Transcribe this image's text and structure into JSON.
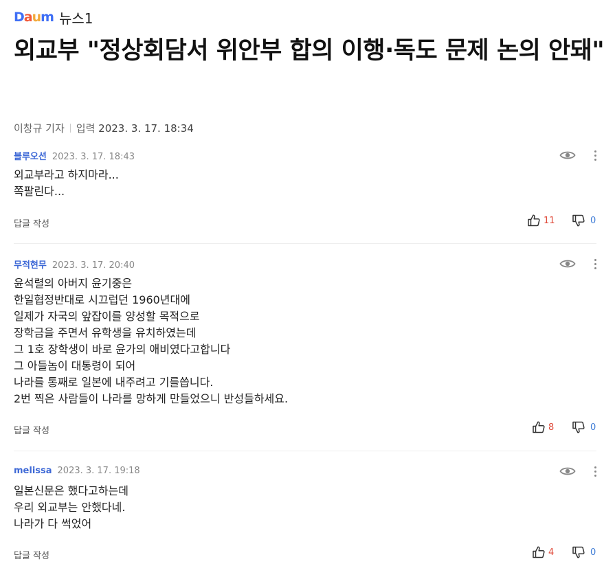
{
  "header": {
    "logo_letters": [
      "D",
      "a",
      "u",
      "m"
    ],
    "logo_colors": [
      "#3f6ff5",
      "#f25a3a",
      "#f2a93b",
      "#3f6ff5"
    ],
    "source": "뉴스1"
  },
  "article": {
    "title": "외교부 \"정상회담서 위안부 합의 이행·독도 문제 논의 안돼\"",
    "reporter": "이창규 기자",
    "date_label": "입력",
    "date": "2023. 3. 17. 18:34"
  },
  "comments": [
    {
      "author": "블루오션",
      "time": "2023. 3. 17. 18:43",
      "body": "외교부라고 하지마라...\n쪽팔린다...",
      "reply_label": "답글 작성",
      "likes": "11",
      "dislikes": "0"
    },
    {
      "author": "무적현무",
      "time": "2023. 3. 17. 20:40",
      "body": "윤석렬의 아버지 윤기중은\n한일협정반대로 시끄럽던 1960년대에\n일제가 자국의 앞잡이를 양성할 목적으로\n장학금을 주면서 유학생을 유치하였는데\n그 1호 장학생이  바로 윤가의 애비였다고합니다\n그 아들놈이  대통령이 되어\n나라를 통째로  일본에  내주려고 기를씁니다.\n2번 찍은  사람들이 나라를 망하게  만들었으니 반성들하세요.",
      "reply_label": "답글 작성",
      "likes": "8",
      "dislikes": "0"
    },
    {
      "author": "melissa",
      "time": "2023. 3. 17. 19:18",
      "body": "일본신문은 했다고하는데\n우리 외교부는 안했다네.\n나라가 다 썩었어",
      "reply_label": "답글 작성",
      "likes": "4",
      "dislikes": "0"
    }
  ],
  "icons": {
    "view": "eye-icon",
    "more": "kebab-menu-icon",
    "like": "thumbs-up-icon",
    "dislike": "thumbs-down-icon"
  },
  "colors": {
    "author": "#3d68d6",
    "like_count": "#e04a3a",
    "dislike_count": "#3d7bd6"
  }
}
